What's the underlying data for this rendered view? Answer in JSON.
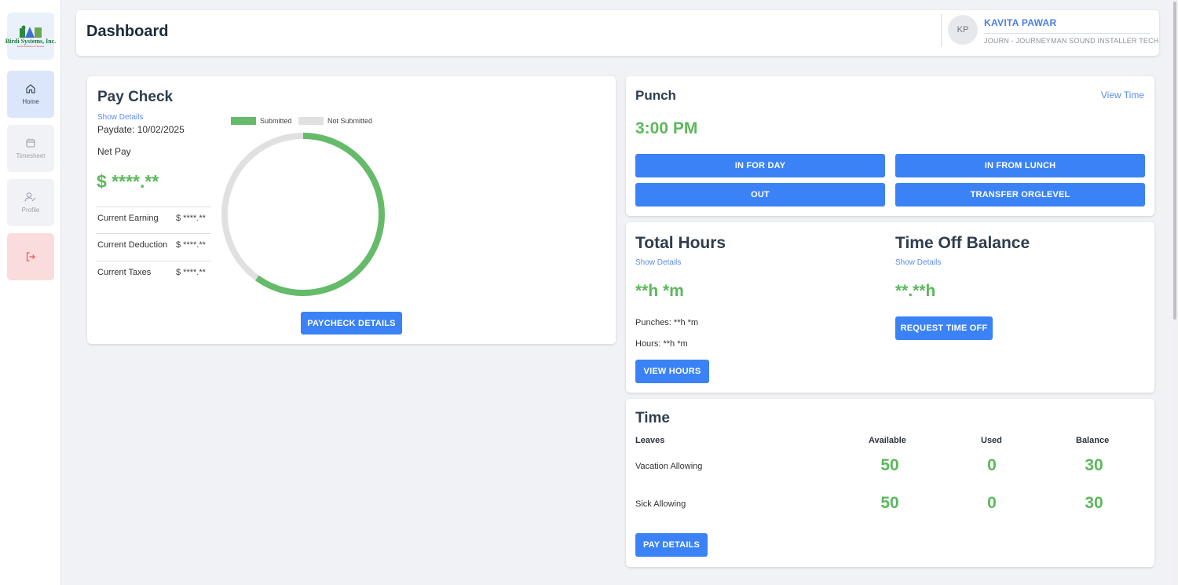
{
  "brand": {
    "name": "Birdi Systems, Inc.",
    "tagline": "Fresh Solutions & Service"
  },
  "sidebar": {
    "items": [
      {
        "label": "Home",
        "icon": "home-icon"
      },
      {
        "label": "Timesheet",
        "icon": "calendar-icon"
      },
      {
        "label": "Profile",
        "icon": "user-icon"
      },
      {
        "label": "",
        "icon": "logout-icon"
      }
    ]
  },
  "header": {
    "title": "Dashboard",
    "avatar_initials": "KP",
    "user_name": "KAVITA PAWAR",
    "user_role": "JOURN - JOURNEYMAN SOUND INSTALLER TECH"
  },
  "paycheck": {
    "title": "Pay Check",
    "show_details": "Show Details",
    "paydate": "Paydate: 10/02/2025",
    "net_pay_label": "Net Pay",
    "net_pay_value": "$ ****.**",
    "rows": [
      {
        "label": "Current Earning",
        "value": "$ ****.**"
      },
      {
        "label": "Current Deduction",
        "value": "$ ****.**"
      },
      {
        "label": "Current Taxes",
        "value": "$ ****.**"
      }
    ],
    "button": "PAYCHECK DETAILS",
    "chart_data": {
      "type": "pie",
      "labels": [
        "Submitted",
        "Not Submitted"
      ],
      "values": [
        60,
        40
      ],
      "colors": [
        "#66bb6a",
        "#e0e0e0"
      ],
      "legend": "top"
    }
  },
  "punch": {
    "title": "Punch",
    "view_time": "View Time",
    "time": "3:00 PM",
    "buttons": [
      "IN FOR DAY",
      "IN FROM LUNCH",
      "OUT",
      "TRANSFER ORGLEVEL"
    ]
  },
  "total_hours": {
    "title": "Total Hours",
    "show_details": "Show Details",
    "value": "**h *m",
    "punches": "Punches: **h *m",
    "hours": "Hours: **h *m",
    "button": "VIEW HOURS"
  },
  "time_off": {
    "title": "Time Off Balance",
    "show_details": "Show Details",
    "value": "**.**h",
    "button": "REQUEST TIME OFF"
  },
  "time": {
    "title": "Time",
    "headers": [
      "Leaves",
      "Available",
      "Used",
      "Balance"
    ],
    "rows": [
      {
        "leave": "Vacation Allowing",
        "available": "50",
        "used": "0",
        "balance": "30"
      },
      {
        "leave": "Sick Allowing",
        "available": "50",
        "used": "0",
        "balance": "30"
      }
    ],
    "button": "PAY DETAILS"
  },
  "colors": {
    "accent": "#3b82f6",
    "green": "#5cb85c",
    "logout_bg": "#fbdcdc"
  }
}
